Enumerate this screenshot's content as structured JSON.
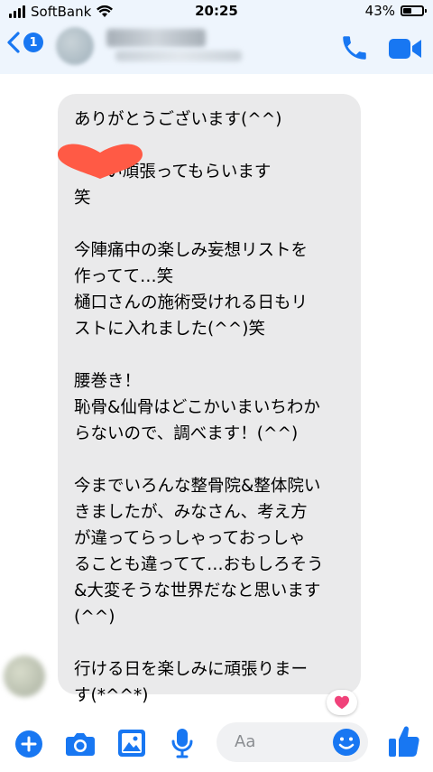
{
  "status_bar": {
    "carrier": "SoftBank",
    "time": "20:25",
    "battery_percent": "43%",
    "battery_level": 0.43
  },
  "header": {
    "back_badge_count": "1"
  },
  "message": {
    "lines": [
      "ありがとうございます(^^)",
      "",
      "      い頑張ってもらいます",
      "笑",
      "",
      "今陣痛中の楽しみ妄想リストを",
      "作ってて…笑",
      "樋口さんの施術受けれる日もリ",
      "ストに入れました(^^)笑",
      "",
      "腰巻き！",
      "恥骨&仙骨はどこかいまいちわか",
      "らないので、調べます！(^^)",
      "",
      "今までいろんな整骨院&整体院い",
      "きましたが、みなさん、考え方",
      "が違ってらっしゃっておっしゃ",
      "ることも違ってて…おもしろそう",
      "&大変そうな世界だなと思います",
      "(^^)",
      "",
      "行ける日を楽しみに頑張りまー",
      "す(*^^*)"
    ]
  },
  "composer": {
    "placeholder": "Aa"
  },
  "colors": {
    "accent": "#1877f2",
    "bubble": "#eaeaeb",
    "header_bg": "#eef5fd",
    "heart": "#ff5a45"
  },
  "icons": {
    "back": "chevron-left-icon",
    "call": "phone-icon",
    "video": "video-camera-icon",
    "add": "plus-icon",
    "camera": "camera-icon",
    "gallery": "image-icon",
    "voice": "microphone-icon",
    "emoji": "smiley-icon",
    "like": "thumbs-up-icon",
    "reaction": "heart-icon"
  }
}
